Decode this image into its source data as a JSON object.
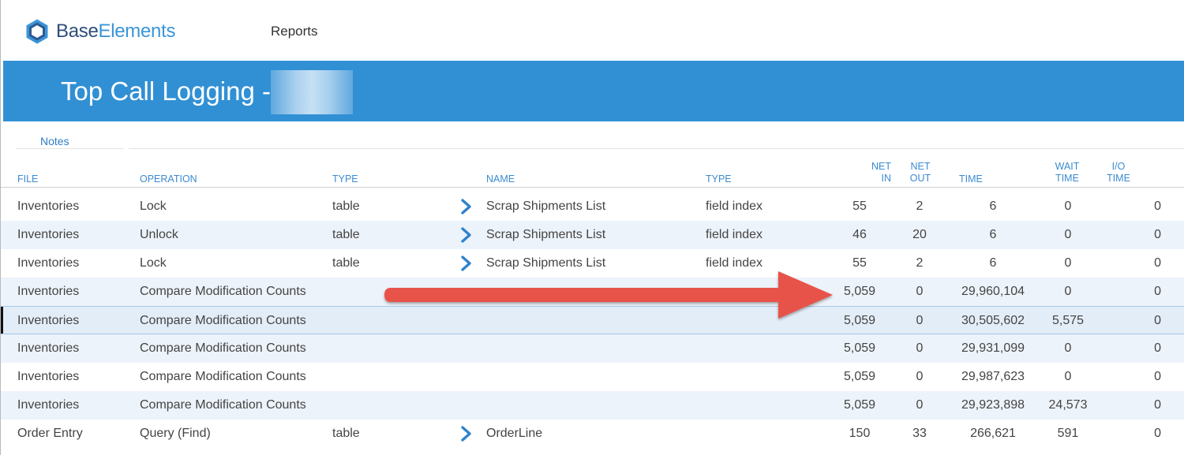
{
  "app": {
    "logo_base": "Base",
    "logo_elements": "Elements",
    "menu_reports": "Reports"
  },
  "header": {
    "title": "Top Call Logging -"
  },
  "tabs": {
    "notes": "Notes"
  },
  "columns": {
    "file": "FILE",
    "operation": "OPERATION",
    "type": "TYPE",
    "name": "NAME",
    "type2": "TYPE",
    "net_in_1": "NET",
    "net_in_2": "IN",
    "net_out_1": "NET",
    "net_out_2": "OUT",
    "time": "TIME",
    "wait_time_1": "WAIT",
    "wait_time_2": "TIME",
    "io_time_1": "I/O",
    "io_time_2": "TIME"
  },
  "rows": [
    {
      "file": "Inventories",
      "operation": "Lock",
      "type": "table",
      "name": "Scrap Shipments List",
      "type2": "field index",
      "net_in": "55",
      "net_out": "2",
      "time": "6",
      "wait_time": "0",
      "io_time": "0"
    },
    {
      "file": "Inventories",
      "operation": "Unlock",
      "type": "table",
      "name": "Scrap Shipments List",
      "type2": "field index",
      "net_in": "46",
      "net_out": "20",
      "time": "6",
      "wait_time": "0",
      "io_time": "0"
    },
    {
      "file": "Inventories",
      "operation": "Lock",
      "type": "table",
      "name": "Scrap Shipments List",
      "type2": "field index",
      "net_in": "55",
      "net_out": "2",
      "time": "6",
      "wait_time": "0",
      "io_time": "0"
    },
    {
      "file": "Inventories",
      "operation": "Compare Modification Counts",
      "type": "",
      "name": "",
      "type2": "",
      "net_in": "5,059",
      "net_out": "0",
      "time": "29,960,104",
      "wait_time": "0",
      "io_time": "0"
    },
    {
      "file": "Inventories",
      "operation": "Compare Modification Counts",
      "type": "",
      "name": "",
      "type2": "",
      "net_in": "5,059",
      "net_out": "0",
      "time": "30,505,602",
      "wait_time": "5,575",
      "io_time": "0"
    },
    {
      "file": "Inventories",
      "operation": "Compare Modification Counts",
      "type": "",
      "name": "",
      "type2": "",
      "net_in": "5,059",
      "net_out": "0",
      "time": "29,931,099",
      "wait_time": "0",
      "io_time": "0"
    },
    {
      "file": "Inventories",
      "operation": "Compare Modification Counts",
      "type": "",
      "name": "",
      "type2": "",
      "net_in": "5,059",
      "net_out": "0",
      "time": "29,987,623",
      "wait_time": "0",
      "io_time": "0"
    },
    {
      "file": "Inventories",
      "operation": "Compare Modification Counts",
      "type": "",
      "name": "",
      "type2": "",
      "net_in": "5,059",
      "net_out": "0",
      "time": "29,923,898",
      "wait_time": "24,573",
      "io_time": "0"
    },
    {
      "file": "Order Entry",
      "operation": "Query (Find)",
      "type": "table",
      "name": "OrderLine",
      "type2": "",
      "net_in": "150",
      "net_out": "33",
      "time": "266,621",
      "wait_time": "591",
      "io_time": "0"
    }
  ],
  "colors": {
    "header_blue": "#3190d4",
    "link_blue": "#3b8bd0",
    "alt_row": "#edf3fa",
    "arrow_red": "#e8534a"
  },
  "icons": {
    "logo": "hexagon-logo-icon",
    "row_link": "chevron-right-icon",
    "annotation": "red-arrow-icon"
  }
}
